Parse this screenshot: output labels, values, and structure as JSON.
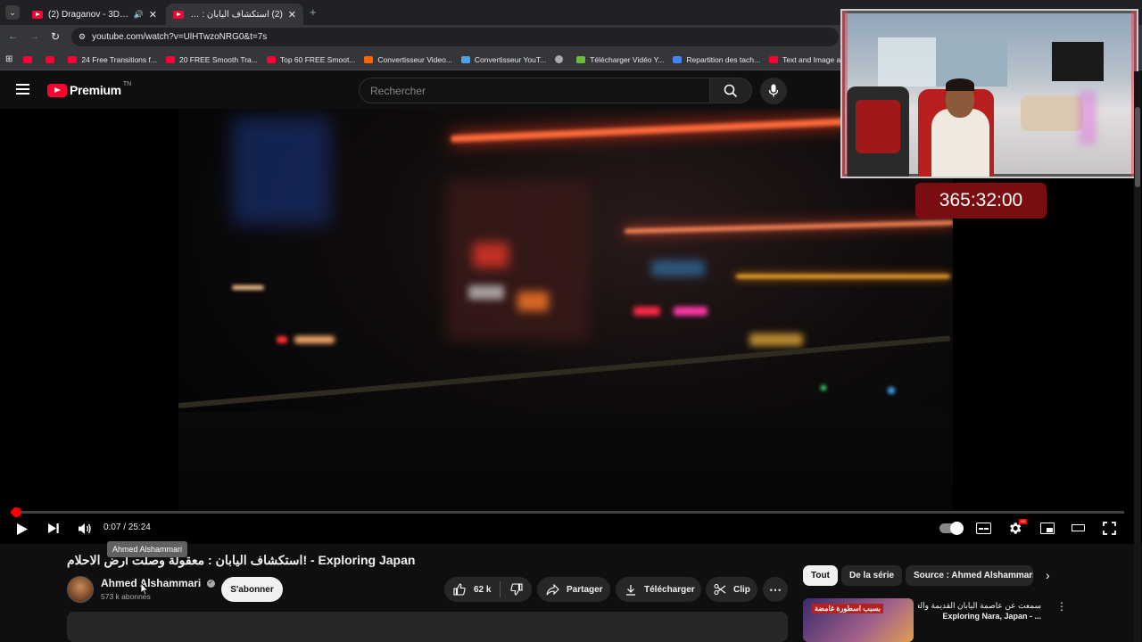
{
  "browser": {
    "tabs": [
      {
        "label": "(2) Draganov - 3DABI (Offic",
        "active": false
      },
      {
        "label": "(2) استكشاف اليابان : معقولة وح",
        "active": true
      }
    ],
    "url": "youtube.com/watch?v=UlHTwzoNRG0&t=7s",
    "bookmarks": [
      "24 Free Transitions f...",
      "20 FREE Smooth Tra...",
      "Top 60 FREE Smoot...",
      "Convertisseur Video...",
      "Convertisseur YouT...",
      "Télécharger Vidéo Y...",
      "Repartition des tach...",
      "Text and Image ani..."
    ]
  },
  "youtube": {
    "logo_text": "Premium",
    "logo_sup": "TN",
    "search_placeholder": "Rechercher"
  },
  "player": {
    "time": "0:07 / 25:24",
    "progress_fraction": 0.005
  },
  "video": {
    "title": "استكشاف اليابان : معقولة وصلت أرض الاحلام! - Exploring Japan",
    "tooltip": "Ahmed Alshammari",
    "channel": "Ahmed Alshammari",
    "subscribers": "573 k abonnés",
    "subscribe_label": "S'abonner",
    "likes": "62 k",
    "share_label": "Partager",
    "download_label": "Télécharger",
    "clip_label": "Clip"
  },
  "sidebar": {
    "chips": [
      "Tout",
      "De la série",
      "Source : Ahmed Alshammari"
    ],
    "next_video_title": "سمعت عن عاصمة اليابان القديمة والغزلان",
    "next_video_title2": "Exploring Nara, Japan - ...",
    "thumb_overlay": "بسبب اسطورة غامضة"
  },
  "overlay": {
    "timer": "365:32:00"
  },
  "colors": {
    "accent": "#ff0000",
    "background": "#0f0f0f",
    "timer_bg": "#7a0d11"
  }
}
